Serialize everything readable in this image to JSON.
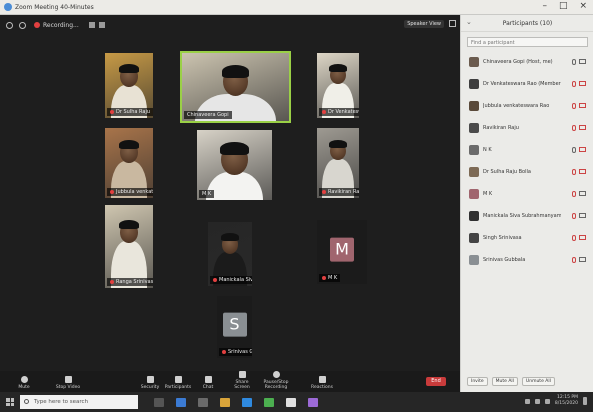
{
  "window": {
    "title": "Zoom Meeting 40-Minutes"
  },
  "meeting_bar": {
    "recording_label": "Recording...",
    "speaker_view_label": "Speaker View"
  },
  "tiles": [
    {
      "name": "Dr Sulha Raju",
      "kind": "video",
      "wall": "#c79a46",
      "shirt": "#e8e2d4",
      "muted": true
    },
    {
      "name": "Chinaveera Gopi",
      "kind": "video",
      "wall": "#ccc4b0",
      "shirt": "#e6e6e6",
      "muted": false,
      "active": true
    },
    {
      "name": "Dr Venkateswara Prasad",
      "kind": "video",
      "wall": "#ddd6c6",
      "shirt": "#f0efe8",
      "muted": true
    },
    {
      "name": "Jubbula venkateswara Rao",
      "kind": "video",
      "wall": "#a8744a",
      "shirt": "#c9b8a0",
      "muted": true
    },
    {
      "name": "M K",
      "kind": "video",
      "wall": "#d7d2c7",
      "shirt": "#f3f3f1",
      "muted": false
    },
    {
      "name": "Ravikiran Raju",
      "kind": "video",
      "wall": "#9e9a92",
      "shirt": "#d8d6cf",
      "muted": true
    },
    {
      "name": "Ranga Srinivasa",
      "kind": "video",
      "wall": "#cfc6b0",
      "shirt": "#e9e6dc",
      "muted": true
    },
    {
      "name": "Manickala Siva Kumar",
      "kind": "video",
      "wall": "#262626",
      "shirt": "#1b1b1b",
      "muted": true
    },
    {
      "name": "M K",
      "kind": "avatar",
      "letter": "M",
      "avatar_color": "#a0656e",
      "muted": true
    },
    {
      "name": "Srinivas Gubbala",
      "kind": "avatar",
      "letter": "S",
      "avatar_color": "#8a8f93",
      "muted": true
    }
  ],
  "toolbar": {
    "items": [
      {
        "label": "Mute",
        "icon": "microphone-icon"
      },
      {
        "label": "Stop Video",
        "icon": "video-camera-icon"
      },
      {
        "label": "Security",
        "icon": "shield-icon"
      },
      {
        "label": "Participants",
        "icon": "participants-icon"
      },
      {
        "label": "Chat",
        "icon": "chat-icon"
      },
      {
        "label": "Share Screen",
        "icon": "share-screen-icon"
      },
      {
        "label": "Pause/Stop Recording",
        "icon": "record-icon"
      },
      {
        "label": "Reactions",
        "icon": "reactions-icon"
      }
    ],
    "end_label": "End"
  },
  "panel": {
    "title": "Participants (10)",
    "search_placeholder": "Find a participant",
    "participants": [
      {
        "name": "Chinaveera Gopi (Host, me)",
        "color": "#6b5b4e",
        "mic_off": false,
        "cam_off": false
      },
      {
        "name": "Dr Venkateswara Rao (Member)",
        "color": "#3e3e3e",
        "mic_off": true,
        "cam_off": true
      },
      {
        "name": "Jubbula venkateswara Rao",
        "color": "#5a4a3a",
        "mic_off": true,
        "cam_off": true
      },
      {
        "name": "Ravikiran Raju",
        "color": "#4b4b4b",
        "mic_off": true,
        "cam_off": true
      },
      {
        "name": "N K",
        "color": "#6b6b6b",
        "mic_off": false,
        "cam_off": true
      },
      {
        "name": "Dr Sulha Raju Bolla",
        "color": "#7d6a55",
        "mic_off": true,
        "cam_off": true
      },
      {
        "name": "M K",
        "color": "#a0656e",
        "mic_off": true,
        "cam_off": false
      },
      {
        "name": "Manickala Siva Subrahmanyam",
        "color": "#303030",
        "mic_off": true,
        "cam_off": false
      },
      {
        "name": "Singh Srinivasa",
        "color": "#444444",
        "mic_off": true,
        "cam_off": true
      },
      {
        "name": "Srinivas Gubbala",
        "color": "#8a8f93",
        "mic_off": true,
        "cam_off": false
      }
    ],
    "footer": [
      "Invite",
      "Mute All",
      "Unmute All"
    ]
  },
  "taskbar": {
    "search_placeholder": "Type here to search",
    "time": "12:15 PM",
    "date": "8/15/2020"
  }
}
